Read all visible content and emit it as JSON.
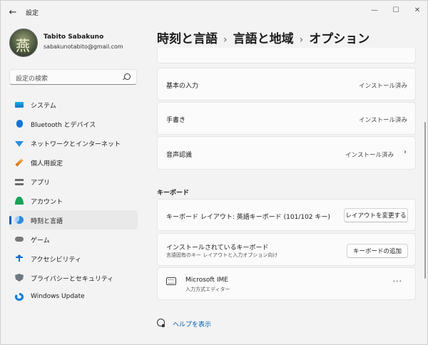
{
  "app": {
    "title": "設定"
  },
  "window_controls": {
    "minimize": "—",
    "maximize": "☐",
    "close": "✕"
  },
  "profile": {
    "name": "Tabito Sabakuno",
    "email": "sabakunotabito@gmail.com"
  },
  "search": {
    "placeholder": "設定の検索"
  },
  "sidebar": {
    "items": [
      {
        "label": "システム",
        "icon": "system-icon"
      },
      {
        "label": "Bluetooth とデバイス",
        "icon": "bluetooth-icon"
      },
      {
        "label": "ネットワークとインターネット",
        "icon": "network-icon"
      },
      {
        "label": "個人用設定",
        "icon": "personalization-icon"
      },
      {
        "label": "アプリ",
        "icon": "apps-icon"
      },
      {
        "label": "アカウント",
        "icon": "accounts-icon"
      },
      {
        "label": "時刻と言語",
        "icon": "time-language-icon",
        "active": true
      },
      {
        "label": "ゲーム",
        "icon": "gaming-icon"
      },
      {
        "label": "アクセシビリティ",
        "icon": "accessibility-icon"
      },
      {
        "label": "プライバシーとセキュリティ",
        "icon": "privacy-icon"
      },
      {
        "label": "Windows Update",
        "icon": "windows-update-icon"
      }
    ]
  },
  "breadcrumb": {
    "level1": "時刻と言語",
    "level2": "言語と地域",
    "current": "オプション",
    "separator": "›"
  },
  "features": [
    {
      "title": "基本の入力",
      "status": "インストール済み"
    },
    {
      "title": "手書き",
      "status": "インストール済み"
    },
    {
      "title": "音声認識",
      "status": "インストール済み"
    }
  ],
  "keyboard": {
    "section_title": "キーボード",
    "layout": {
      "title": "キーボード レイアウト: 英語キーボード (101/102 キー)",
      "button": "レイアウトを変更する"
    },
    "installed": {
      "title": "インストールされているキーボード",
      "subtitle": "言語固有のキー レイアウトと入力オプション向け",
      "button": "キーボードの追加"
    },
    "ime": {
      "title": "Microsoft IME",
      "subtitle": "入力方式エディター",
      "more": "···"
    }
  },
  "help": {
    "label": "ヘルプを表示"
  },
  "accent_color": "#005fb8"
}
